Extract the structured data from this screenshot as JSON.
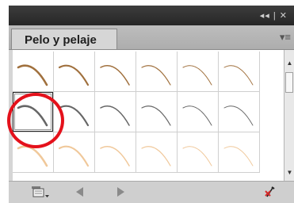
{
  "panel": {
    "titlebar_controls": "◂◂ | ✕",
    "tab_label": "Pelo y pelaje",
    "menu_icon": "panel-menu-icon"
  },
  "brush_rows": [
    {
      "color": "#a0703d",
      "widths": [
        2.6,
        2.2,
        1.5,
        1.2,
        1.0,
        0.9
      ]
    },
    {
      "color": "#666666",
      "widths": [
        2.6,
        2.2,
        1.5,
        1.2,
        1.0,
        0.9
      ]
    },
    {
      "color": "#f0c89a",
      "widths": [
        2.6,
        2.2,
        1.5,
        1.2,
        1.0,
        0.9
      ]
    }
  ],
  "selected_brush": {
    "row": 1,
    "col": 0
  },
  "toolbar": {
    "library_menu_icon": "brush-library-menu-icon",
    "prev_icon": "previous-library-icon",
    "next_icon": "next-library-icon",
    "remove_stroke_icon": "remove-brush-stroke-icon"
  },
  "colors": {
    "annotation_circle": "#e4111b",
    "remove_icon_red": "#d42a2a"
  }
}
